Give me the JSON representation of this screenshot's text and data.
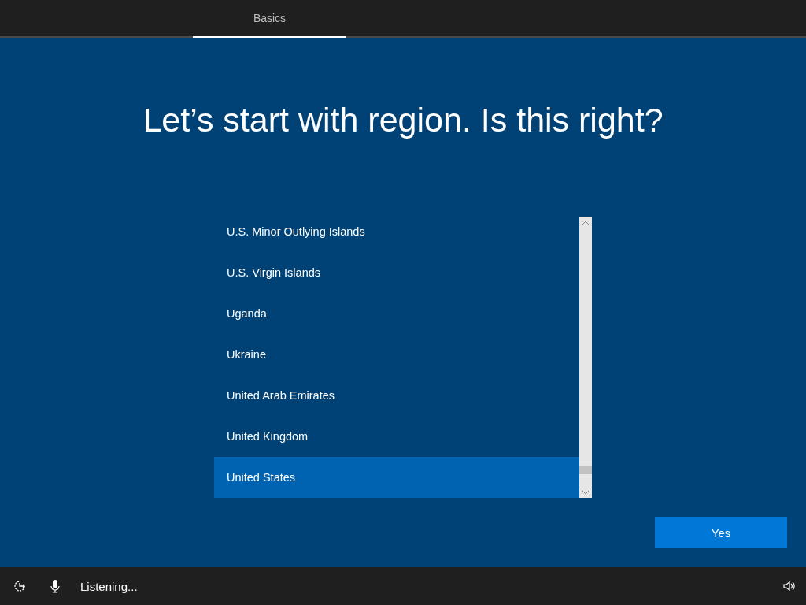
{
  "tabs": [
    {
      "label": "Basics",
      "selected": true
    }
  ],
  "heading": "Let’s start with region. Is this right?",
  "regions": [
    {
      "label": "U.S. Minor Outlying Islands",
      "selected": false
    },
    {
      "label": "U.S. Virgin Islands",
      "selected": false
    },
    {
      "label": "Uganda",
      "selected": false
    },
    {
      "label": "Ukraine",
      "selected": false
    },
    {
      "label": "United Arab Emirates",
      "selected": false
    },
    {
      "label": "United Kingdom",
      "selected": false
    },
    {
      "label": "United States",
      "selected": true
    }
  ],
  "buttons": [
    "Yes"
  ],
  "status_bar": {
    "voice_status": "Listening..."
  }
}
